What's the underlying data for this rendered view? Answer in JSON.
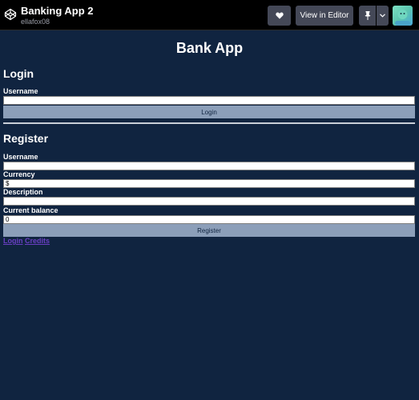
{
  "codepen_header": {
    "pen_title": "Banking App 2",
    "author": "ellafox08",
    "view_in_editor_label": "View in Editor",
    "logo_icon": "codepen-logo-icon",
    "heart_icon": "heart-icon",
    "pin_icon": "pin-icon",
    "caret_icon": "chevron-down-icon"
  },
  "app": {
    "title": "Bank App",
    "login": {
      "heading": "Login",
      "username_label": "Username",
      "username_value": "",
      "button_label": "Login"
    },
    "register": {
      "heading": "Register",
      "username_label": "Username",
      "username_value": "",
      "currency_label": "Currency",
      "currency_value": "$",
      "description_label": "Description",
      "description_value": "",
      "balance_label": "Current balance",
      "balance_value": "0",
      "button_label": "Register"
    },
    "nav_links": {
      "login": "Login",
      "credits": "Credits"
    }
  },
  "colors": {
    "header_bg": "#000000",
    "preview_bg": "#102440",
    "button_bg": "#8c9fb9",
    "link": "#6a3fc4"
  }
}
